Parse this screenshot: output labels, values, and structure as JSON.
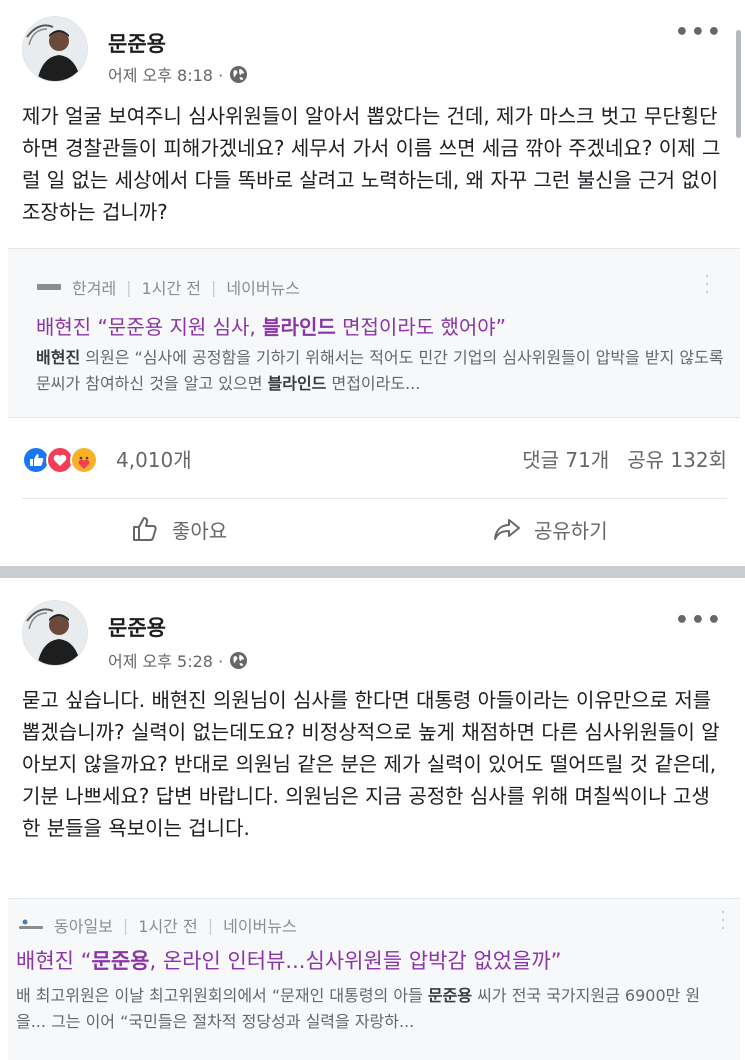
{
  "posts": [
    {
      "author": "문준용",
      "time": "어제 오후 8:18 ·",
      "text": "제가 얼굴 보여주니 심사위원들이 알아서 뽑았다는 건데, 제가 마스크 벗고 무단횡단하면 경찰관들이 피해가겠네요? 세무서 가서 이름 쓰면 세금 깎아 주겠네요? 이제 그럴 일 없는 세상에서 다들 똑바로 살려고 노력하는데, 왜 자꾸 그런 불신을 근거 없이 조장하는 겁니까?",
      "link": {
        "source": "한겨레",
        "age": "1시간 전",
        "via": "네이버뉴스",
        "title_pre": "배현진 “문준용 지원 심사, ",
        "title_bold": "블라인드",
        "title_post": " 면접이라도 했어야”",
        "desc_bold1": "배현진",
        "desc_mid": " 의원은 “심사에 공정함을 기하기 위해서는 적어도 민간 기업의 심사위원들이 압박을 받지 않도록 문씨가 참여하신 것을 알고 있으면 ",
        "desc_bold2": "블라인드",
        "desc_end": " 면접이라도..."
      },
      "reactions_count": "4,010개",
      "comments": "댓글 71개",
      "shares": "공유 132회",
      "like_label": "좋아요",
      "share_label": "공유하기"
    },
    {
      "author": "문준용",
      "time": "어제 오후 5:28 ·",
      "text": "묻고 싶습니다. 배현진 의원님이 심사를 한다면 대통령 아들이라는 이유만으로 저를 뽑겠습니까? 실력이 없는데도요? 비정상적으로 높게 채점하면 다른 심사위원들이 알아보지 않을까요? 반대로 의원님 같은 분은 제가 실력이 있어도 떨어뜨릴 것 같은데, 기분 나쁘세요? 답변 바랍니다. 의원님은 지금 공정한 심사를 위해 며칠씩이나 고생한 분들을 욕보이는 겁니다.",
      "link": {
        "source": "동아일보",
        "age": "1시간 전",
        "via": "네이버뉴스",
        "title_pre": "배현진 “",
        "title_bold": "문준용",
        "title_post": ", 온라인 인터뷰...심사위원들 압박감 없었을까”",
        "desc_pre": "배 최고위원은 이날 최고위원회의에서 “문재인 대통령의 아들 ",
        "desc_bold": "문준용",
        "desc_post": " 씨가 전국 국가지원금 6900만 원을... 그는 이어 “국민들은 절차적 정당성과 실력을 자랑하..."
      }
    }
  ],
  "colors": {
    "link_title": "#8b35a8",
    "like_blue": "#1877f2",
    "love_red": "#f33e58",
    "care_yellow": "#f7b125",
    "divider": "#c9ccd1"
  }
}
